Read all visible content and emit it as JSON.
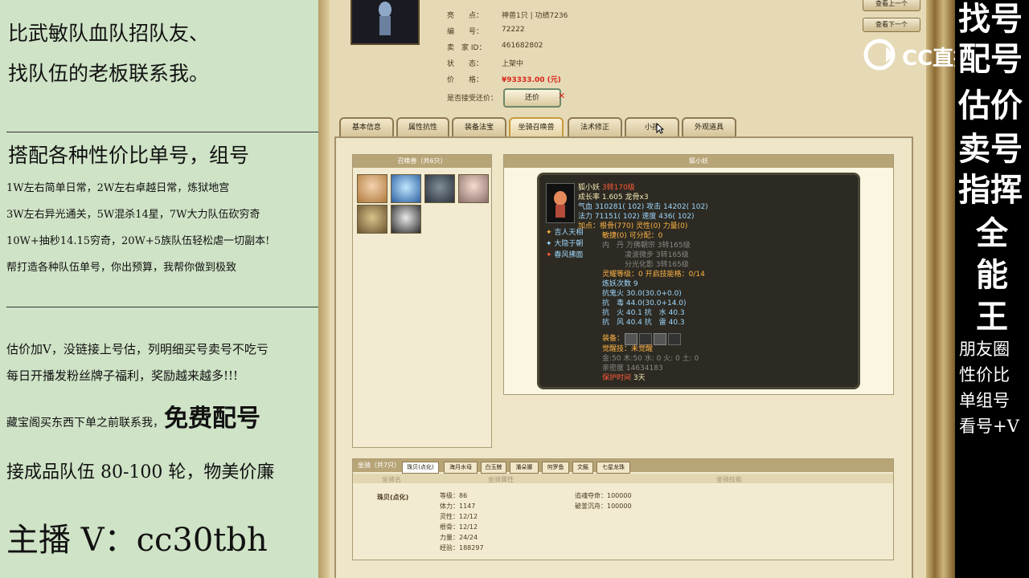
{
  "left_panel": {
    "line1": "比武敏队血队招队友、",
    "line2": "找队伍的老板联系我。",
    "heading": "搭配各种性价比单号，组号",
    "items": [
      "1W左右简单日常，2W左右卓越日常，炼狱地宫",
      "3W左右异光通关，5W混杀14星，7W大力队伍砍穷奇",
      "10W+抽秒14.15穷奇，20W+5族队伍轻松虐一切副本!",
      "帮打造各种队伍单号，你出预算，我帮你做到极致"
    ],
    "notes": [
      "估价加V，没链接上号估，列明细买号卖号不吃亏",
      "每日开播发粉丝牌子福利，奖励越来越多!!!"
    ],
    "note3_prefix": "藏宝阁买东西下单之前联系我，",
    "note3_bold": "免费配号",
    "note4": "接成品队伍 80-100 轮，物美价廉",
    "anchor": "主播 V：cc30tbh"
  },
  "right_panel": {
    "big_rows": [
      "找号",
      "配号",
      "估价",
      "卖号",
      "指挥",
      "全",
      "能",
      "王"
    ],
    "small_rows": [
      "朋友圈",
      "性价比",
      "单组号",
      "看号+V"
    ]
  },
  "watermark": "CC直播",
  "listing": {
    "rows": [
      {
        "label": "亮　　点：",
        "value": "神兽1只 | 功绩7236"
      },
      {
        "label": "编　　号：",
        "value": "72222"
      },
      {
        "label": "卖　家 ID：",
        "value": "461682802"
      },
      {
        "label": "状　　态：",
        "value": "上架中"
      },
      {
        "label": "价　　格：",
        "value": "¥93333.00 (元)"
      }
    ],
    "bargain_label": "是否接受还价：",
    "bargain_btn": "还价",
    "prev_btn": "查看上一个",
    "next_btn": "查看下一个"
  },
  "tabs": [
    "基本信息",
    "属性抗性",
    "装备法宝",
    "坐骑召唤兽",
    "法术修正",
    "小孩",
    "外观道具"
  ],
  "summons_panel": {
    "title": "召唤兽（共6只）"
  },
  "pet_detail": {
    "title": "狐小妖",
    "name": "狐小妖",
    "level": "3转170级",
    "growth": "成长率 1.605 龙骨x3",
    "qixue": "气血 310281( 102) 攻击 14202( 102)",
    "fali": "法力 71151( 102) 速度 436( 102)",
    "jiadian1": "加点：根骨(770) 灵性(0) 力量(0)",
    "jiadian2": "敏捷(0) 可分配：0",
    "neidan1": "内　丹 万佛朝宗 3转165级",
    "neidan2": "凌波微步 3转165级",
    "neidan3": "分光化影 3转165级",
    "lingshou": "灵耀等级：0 开启技能格：0/14",
    "lianyao": "炼妖次数 9",
    "kang1": "抗鬼火 30.0(30.0+0.0)",
    "kang2": "抗　毒 44.0(30.0+14.0)",
    "kang3": "抗　火 40.1 抗　水 40.3",
    "kang4": "抗　风 40.4 抗　雷 40.3",
    "equip": "装备：",
    "juexing": "觉醒技：未觉醒",
    "wuxing": "金:50 木:50 水: 0 火: 0 土: 0",
    "qinmi": "亲密度 14634183",
    "protect_label": "保护时间",
    "protect_val": "3天",
    "skills": [
      "吉人天相",
      "大隐于朝",
      "春风拂面"
    ]
  },
  "mounts": {
    "title": "坐骑（共7只）",
    "tabs": [
      "珠贝(点化)",
      "海月水母",
      "白玉鲸",
      "潘朵娜",
      "何罗鱼",
      "文鳐",
      "七星龙珠"
    ],
    "headers": [
      "坐骑名",
      "坐骑属性",
      "坐骑技能"
    ],
    "name": "珠贝(点化)",
    "stats": [
      "等级：86",
      "体力：1147",
      "灵性：12/12",
      "根骨：12/12",
      "力量：24/24",
      "经验：188297"
    ],
    "skills": [
      "追魂夺命：100000",
      "破釜沉舟：100000"
    ]
  },
  "colors": {
    "left_bg": "#cfe3c6",
    "game_bg": "#e6d9b6",
    "price": "#d9261c",
    "accent": "#c69a3a"
  }
}
